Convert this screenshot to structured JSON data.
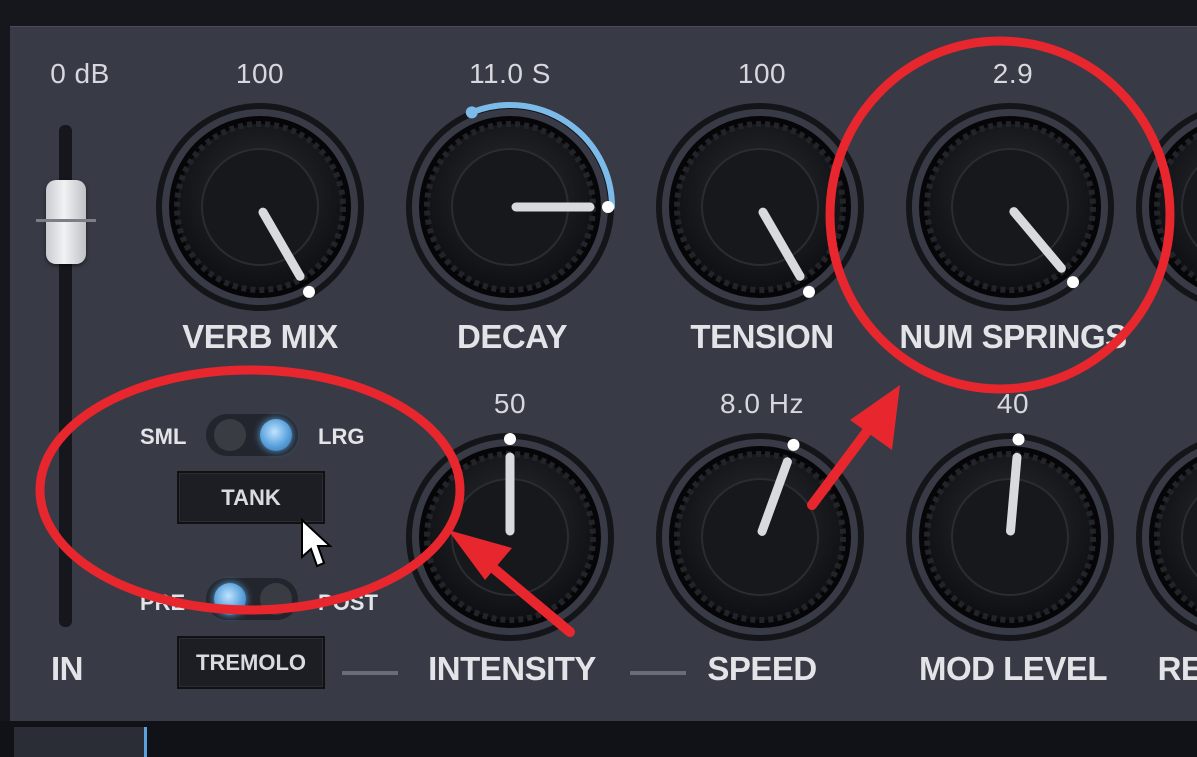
{
  "fader": {
    "value": "0 dB",
    "label": "IN"
  },
  "knobs_top": [
    {
      "label": "VERB MIX",
      "value": "100"
    },
    {
      "label": "DECAY",
      "value": "11.0 S"
    },
    {
      "label": "TENSION",
      "value": "100"
    },
    {
      "label": "NUM SPRINGS",
      "value": "2.9"
    }
  ],
  "knobs_bottom": [
    {
      "label": "INTENSITY",
      "value": "50"
    },
    {
      "label": "SPEED",
      "value": "8.0 Hz"
    },
    {
      "label": "MOD LEVEL",
      "value": "40"
    },
    {
      "label": "RE"
    }
  ],
  "tank": {
    "left": "SML",
    "right": "LRG",
    "button": "TANK",
    "selected": "LRG"
  },
  "tremolo": {
    "left": "PRE",
    "right": "POST",
    "button": "TREMOLO",
    "selected": "PRE"
  },
  "colors": {
    "accent": "#5aa2dd",
    "annotation": "#e8262d",
    "panel": "#383b46"
  }
}
